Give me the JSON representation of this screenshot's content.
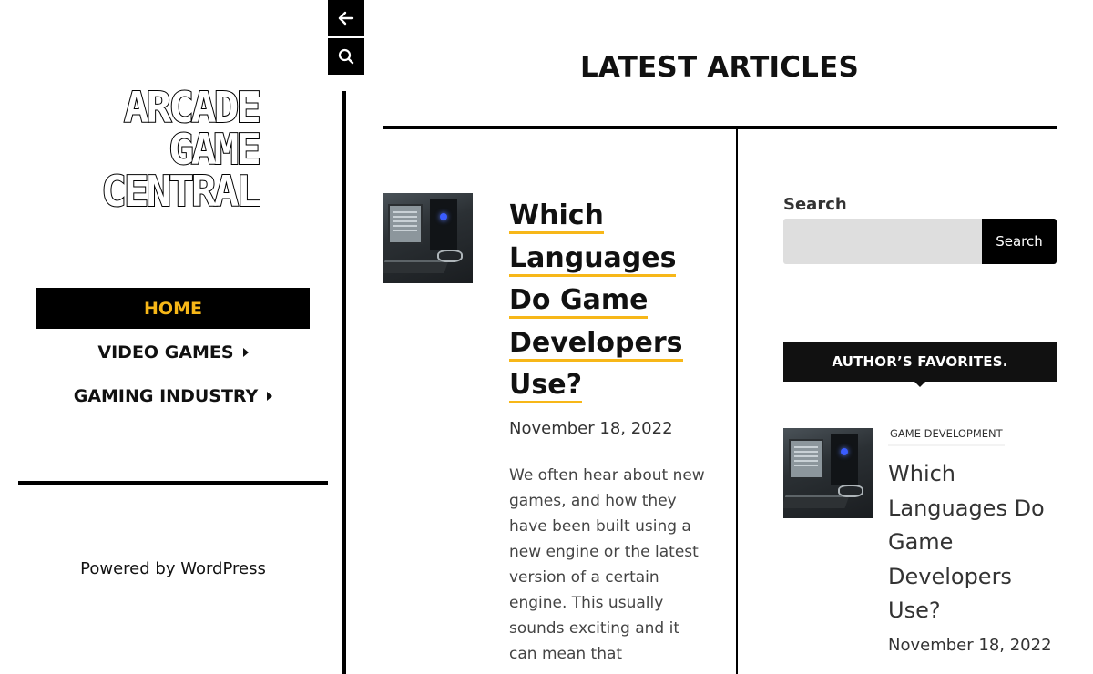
{
  "site": {
    "logo_lines": [
      "ARCADE",
      "GAME",
      "CENTRAL"
    ]
  },
  "nav": {
    "items": [
      {
        "label": "HOME",
        "active": true,
        "has_submenu": false
      },
      {
        "label": "VIDEO GAMES",
        "active": false,
        "has_submenu": true
      },
      {
        "label": "GAMING INDUSTRY",
        "active": false,
        "has_submenu": true
      }
    ]
  },
  "footer": {
    "powered_by": "Powered by WordPress"
  },
  "toolbar": {
    "back_icon": "arrow-left-icon",
    "search_icon": "search-icon"
  },
  "main": {
    "page_title": "LATEST ARTICLES",
    "article": {
      "title_lines": [
        "Which",
        "Languages",
        "Do Game",
        "Developers",
        "Use?"
      ],
      "date": "November 18, 2022",
      "excerpt": "We often hear about new games, and how they have been built using a new engine or the latest version of a certain engine. This usually sounds exciting and it can mean that"
    }
  },
  "widgets": {
    "search": {
      "label": "Search",
      "placeholder": "",
      "button_label": "Search"
    },
    "favorites": {
      "heading": "AUTHOR’S FAVORITES.",
      "post": {
        "category": "GAME DEVELOPMENT",
        "title": "Which Languages Do Game Developers Use?",
        "date": "November 18, 2022"
      }
    }
  },
  "colors": {
    "accent": "#f7b718",
    "nav_active_bg": "#000000",
    "search_input_bg": "#dedede"
  }
}
